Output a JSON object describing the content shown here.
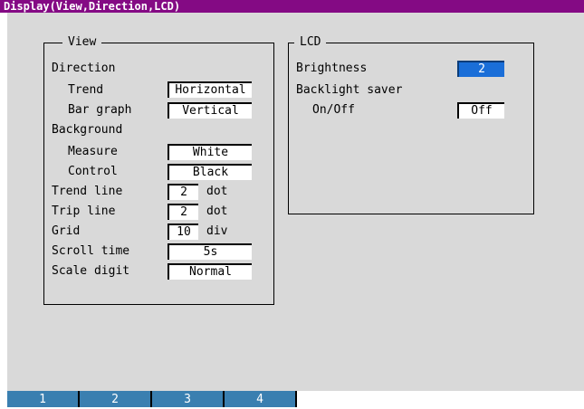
{
  "window": {
    "title": "Display(View,Direction,LCD)"
  },
  "view": {
    "title": "View",
    "direction_label": "Direction",
    "trend_label": "Trend",
    "trend_value": "Horizontal",
    "bargraph_label": "Bar graph",
    "bargraph_value": "Vertical",
    "background_label": "Background",
    "measure_label": "Measure",
    "measure_value": "White",
    "control_label": "Control",
    "control_value": "Black",
    "trendline_label": "Trend line",
    "trendline_value": "2",
    "trendline_unit": "dot",
    "tripline_label": "Trip line",
    "tripline_value": "2",
    "tripline_unit": "dot",
    "grid_label": "Grid",
    "grid_value": "10",
    "grid_unit": "div",
    "scrolltime_label": "Scroll time",
    "scrolltime_value": "5s",
    "scaledigit_label": "Scale digit",
    "scaledigit_value": "Normal"
  },
  "lcd": {
    "title": "LCD",
    "brightness_label": "Brightness",
    "brightness_value": "2",
    "backlight_label": "Backlight saver",
    "onoff_label": "On/Off",
    "onoff_value": "Off"
  },
  "softkeys": [
    "1",
    "2",
    "3",
    "4"
  ],
  "colors": {
    "title_bar": "#840a84",
    "selected": "#1a6ed8",
    "softkey": "#3a7fb0",
    "panel": "#d9d9d9"
  }
}
